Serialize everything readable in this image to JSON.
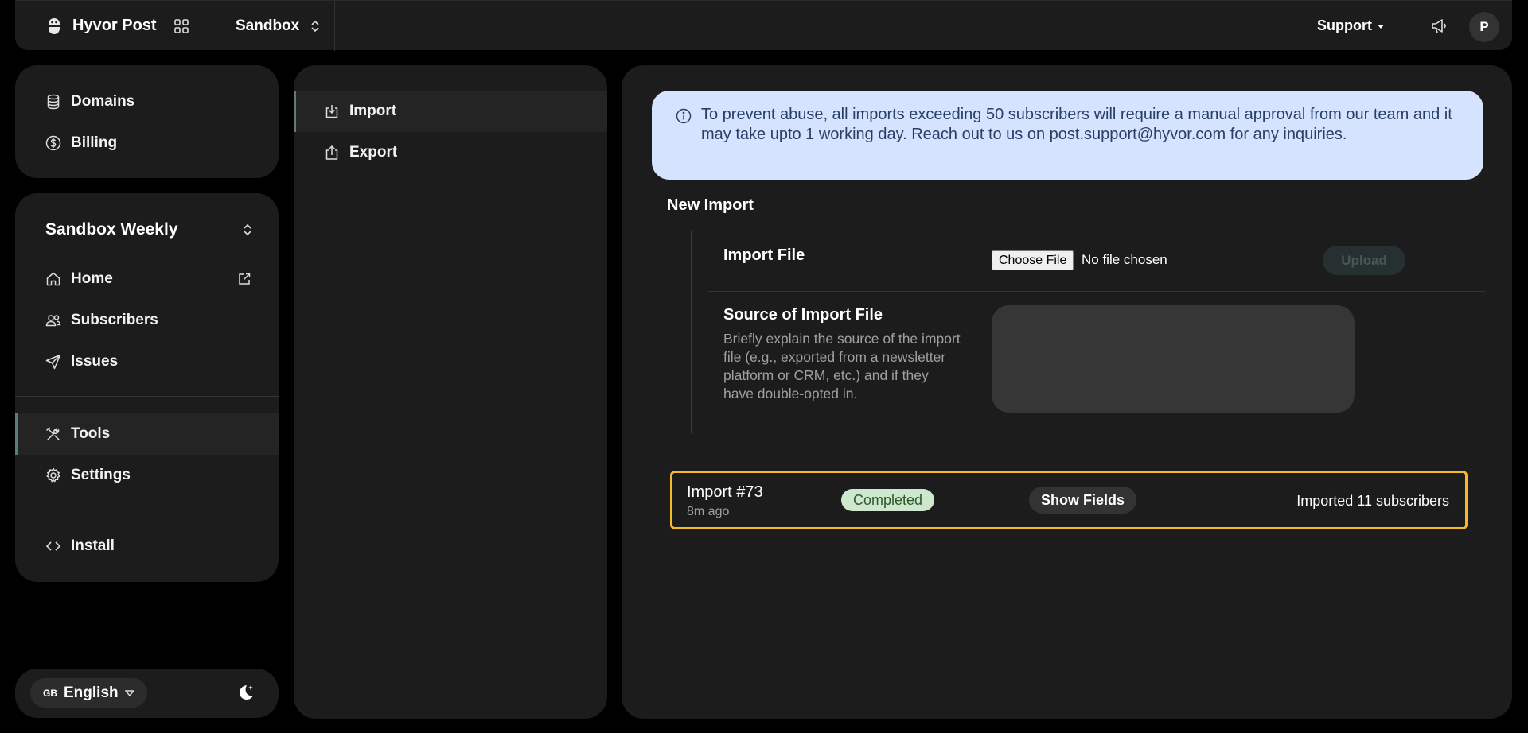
{
  "topbar": {
    "brand": "Hyvor Post",
    "project": "Sandbox",
    "support": "Support",
    "avatar_initial": "P"
  },
  "sidebar": {
    "top_items": [
      {
        "label": "Domains",
        "icon": "database-icon"
      },
      {
        "label": "Billing",
        "icon": "dollar-circle-icon"
      }
    ],
    "newsletter_name": "Sandbox Weekly",
    "main_items": [
      {
        "label": "Home",
        "icon": "home-icon"
      },
      {
        "label": "Subscribers",
        "icon": "users-icon"
      },
      {
        "label": "Issues",
        "icon": "send-icon"
      }
    ],
    "tool_items": [
      {
        "label": "Tools",
        "icon": "tools-icon",
        "active": true
      },
      {
        "label": "Settings",
        "icon": "gear-icon"
      }
    ],
    "install": {
      "label": "Install",
      "icon": "code-icon"
    }
  },
  "footer": {
    "language_flag": "GB",
    "language": "English"
  },
  "tools_nav": {
    "items": [
      {
        "label": "Import",
        "icon": "import-icon",
        "active": true
      },
      {
        "label": "Export",
        "icon": "export-icon"
      }
    ]
  },
  "main": {
    "alert": "To prevent abuse, all imports exceeding 50 subscribers will require a manual approval from our team and it may take upto 1 working day. Reach out to us on post.support@hyvor.com for any inquiries.",
    "section_title": "New Import",
    "import_file_label": "Import File",
    "choose_file": "Choose File",
    "file_status": "No file chosen",
    "upload": "Upload",
    "source_label": "Source of Import File",
    "source_desc": "Briefly explain the source of the import file (e.g., exported from a newsletter platform or CRM, etc.) and if they have double-opted in.",
    "source_value": "",
    "import": {
      "title": "Import #73",
      "time": "8m ago",
      "status": "Completed",
      "show_fields": "Show Fields",
      "summary": "Imported 11 subscribers"
    }
  },
  "colors": {
    "accent_bar": "#5a7d7c",
    "alert_bg": "#d5e3ff",
    "highlight_border": "#f5b82a",
    "badge_bg": "#cfe6cf"
  }
}
